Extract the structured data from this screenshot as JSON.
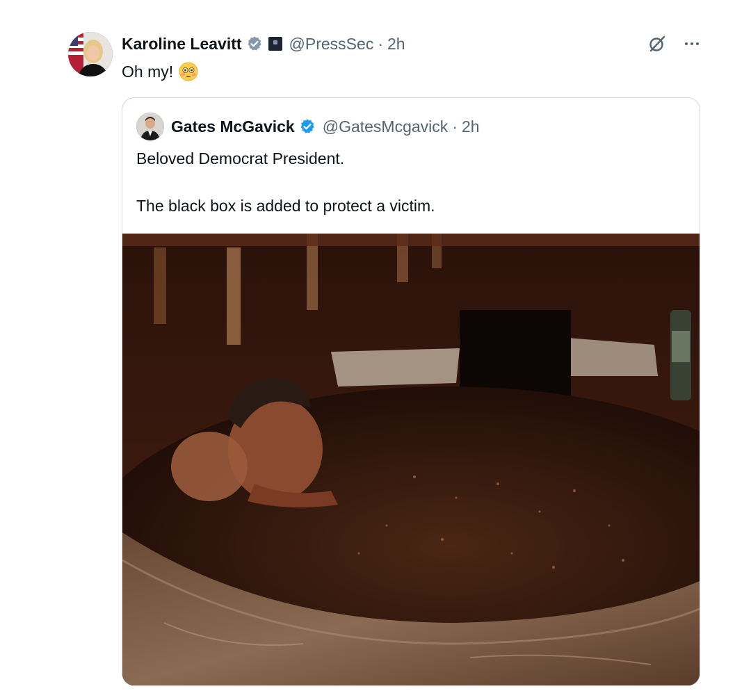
{
  "post": {
    "author": {
      "display_name": "Karoline Leavitt",
      "handle": "@PressSec",
      "separator": "·",
      "time": "2h",
      "verified_badge": "gray-check-badge-icon",
      "affiliation_icon": "white-house-affiliate-icon"
    },
    "text": "Oh my!",
    "emoji": "flushed-face-emoji",
    "actions": {
      "grok": "grok-icon",
      "more": "more-icon"
    }
  },
  "quote": {
    "author": {
      "display_name": "Gates McGavick",
      "handle": "@GatesMcgavick",
      "separator": "·",
      "time": "2h",
      "verified_badge": "blue-check-badge-icon"
    },
    "text": "Beloved Democrat President.\n\nThe black box is added to protect a victim.",
    "media": {
      "description_icon": "photo-media"
    }
  },
  "colors": {
    "text_primary": "#0f1419",
    "text_secondary": "#536471",
    "border": "#cfd9de",
    "verified_blue": "#1d9bf0",
    "verified_gray": "#829aab"
  }
}
